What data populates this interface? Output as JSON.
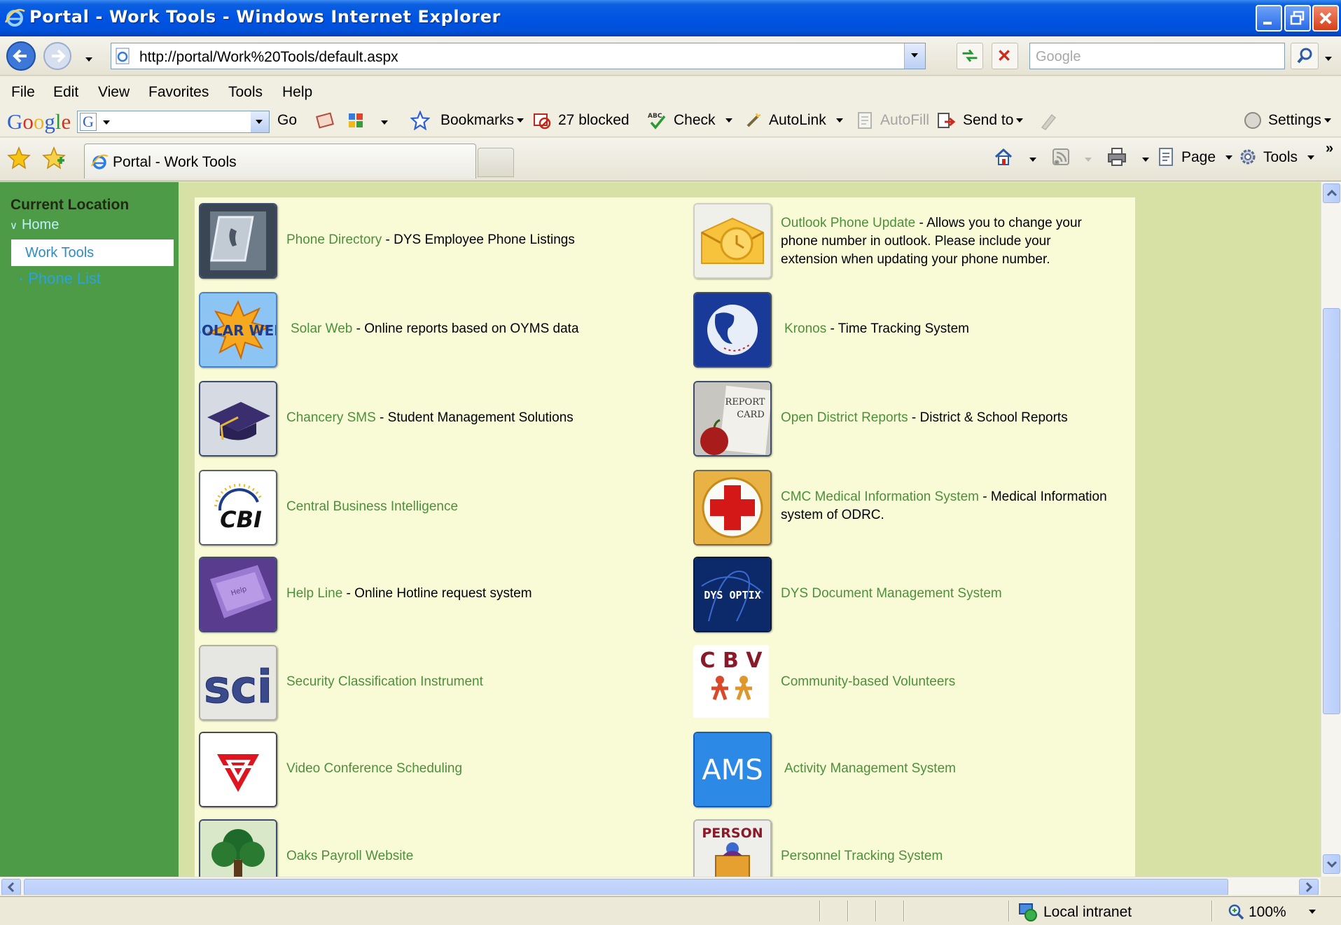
{
  "window": {
    "title": "Portal - Work Tools - Windows Internet Explorer"
  },
  "address": {
    "url": "http://portal/Work%20Tools/default.aspx"
  },
  "search": {
    "placeholder": "Google"
  },
  "menu": [
    "File",
    "Edit",
    "View",
    "Favorites",
    "Tools",
    "Help"
  ],
  "google_toolbar": {
    "logo": "Google",
    "go_label": "Go",
    "bookmarks_label": "Bookmarks",
    "blocked_label": "27 blocked",
    "check_label": "Check",
    "autolink_label": "AutoLink",
    "autofill_label": "AutoFill",
    "sendto_label": "Send to",
    "settings_label": "Settings"
  },
  "tabs": {
    "active_label": "Portal - Work Tools"
  },
  "command_bar": {
    "page_label": "Page",
    "tools_label": "Tools"
  },
  "left_nav": {
    "title": "Current Location",
    "home_label": "Home",
    "current_label": "Work Tools",
    "phone_label": "Phone List"
  },
  "tools": [
    {
      "link": "Phone Directory",
      "desc": " - DYS Employee Phone Listings",
      "icon": "phone-icon"
    },
    {
      "link": "Outlook Phone Update",
      "desc": " - Allows you to change your phone number in outlook. Please include your extension when updating your phone number.",
      "icon": "outlook-icon"
    },
    {
      "link": "Solar Web",
      "desc": " - Online reports based on OYMS data",
      "icon": "solar-web-icon",
      "icon_text": "SOLAR WEB"
    },
    {
      "link": "Kronos",
      "desc": " - Time Tracking System",
      "icon": "globe-icon"
    },
    {
      "link": "Chancery SMS",
      "desc": " - Student Management Solutions",
      "icon": "graduation-cap-icon"
    },
    {
      "link": "Open District Reports",
      "desc": " - District & School Reports",
      "icon": "report-card-icon",
      "icon_text": [
        "REPORT",
        "CARD"
      ]
    },
    {
      "link": "Central Business Intelligence",
      "desc": "",
      "icon": "cbi-icon",
      "icon_text": "CBI"
    },
    {
      "link": "CMC Medical Information System",
      "desc": " - Medical Information system of ODRC.",
      "icon": "red-cross-icon"
    },
    {
      "link": "Help Line",
      "desc": " - Online Hotline request system",
      "icon": "help-key-icon",
      "icon_text": "Help"
    },
    {
      "link": "DYS Document Management System",
      "desc": "",
      "icon": "dys-optix-icon",
      "icon_text": "DYS OPTIX"
    },
    {
      "link": "Security Classification Instrument",
      "desc": "",
      "icon": "sci-icon",
      "icon_text": "sci"
    },
    {
      "link": "Community-based Volunteers",
      "desc": "",
      "icon": "cbv-icon",
      "icon_text": "C B V"
    },
    {
      "link": "Video Conference Scheduling",
      "desc": "",
      "icon": "video-conference-icon"
    },
    {
      "link": "Activity Management System",
      "desc": "",
      "icon": "ams-icon",
      "icon_text": "AMS"
    },
    {
      "link": "Oaks Payroll Website",
      "desc": "",
      "icon": "tree-icon"
    },
    {
      "link": "Personnel Tracking System",
      "desc": "",
      "icon": "person-icon",
      "icon_text": "PERSON"
    }
  ],
  "status": {
    "zone_label": "Local intranet",
    "zoom_label": "100%"
  },
  "colors": {
    "nav_green": "#4e9b47",
    "link_green": "#4d8f3d",
    "panel_bg": "#f9fbd6",
    "page_bg": "#d7e0a5"
  }
}
